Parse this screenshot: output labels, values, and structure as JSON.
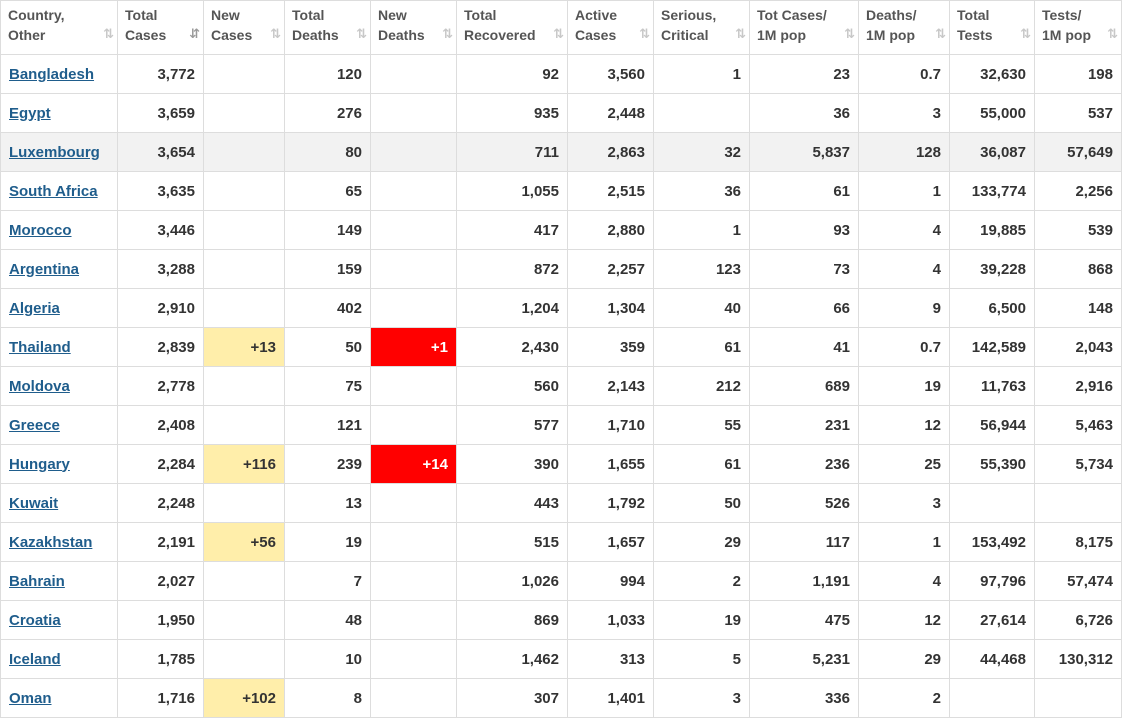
{
  "columns": [
    {
      "line1": "Country,",
      "line2": "Other",
      "sort_glyph": "⇅"
    },
    {
      "line1": "Total",
      "line2": "Cases",
      "sort_glyph": "⇵"
    },
    {
      "line1": "New",
      "line2": "Cases",
      "sort_glyph": "⇅"
    },
    {
      "line1": "Total",
      "line2": "Deaths",
      "sort_glyph": "⇅"
    },
    {
      "line1": "New",
      "line2": "Deaths",
      "sort_glyph": "⇅"
    },
    {
      "line1": "Total",
      "line2": "Recovered",
      "sort_glyph": "⇅"
    },
    {
      "line1": "Active",
      "line2": "Cases",
      "sort_glyph": "⇅"
    },
    {
      "line1": "Serious,",
      "line2": "Critical",
      "sort_glyph": "⇅"
    },
    {
      "line1": "Tot Cases/",
      "line2": "1M pop",
      "sort_glyph": "⇅"
    },
    {
      "line1": "Deaths/",
      "line2": "1M pop",
      "sort_glyph": "⇅"
    },
    {
      "line1": "Total",
      "line2": "Tests",
      "sort_glyph": "⇅"
    },
    {
      "line1": "Tests/",
      "line2": "1M pop",
      "sort_glyph": "⇅"
    }
  ],
  "colors": {
    "new_cases_highlight": "#ffeeaa",
    "new_deaths_highlight": "#ff0000",
    "row_highlight": "#f2f2f2",
    "link": "#1f5d8c"
  },
  "rows": [
    {
      "country": "Bangladesh",
      "total_cases": "3,772",
      "new_cases": "",
      "total_deaths": "120",
      "new_deaths": "",
      "total_recovered": "92",
      "active_cases": "3,560",
      "serious_critical": "1",
      "tot_cases_per_1m": "23",
      "deaths_per_1m": "0.7",
      "total_tests": "32,630",
      "tests_per_1m": "198"
    },
    {
      "country": "Egypt",
      "total_cases": "3,659",
      "new_cases": "",
      "total_deaths": "276",
      "new_deaths": "",
      "total_recovered": "935",
      "active_cases": "2,448",
      "serious_critical": "",
      "tot_cases_per_1m": "36",
      "deaths_per_1m": "3",
      "total_tests": "55,000",
      "tests_per_1m": "537"
    },
    {
      "country": "Luxembourg",
      "total_cases": "3,654",
      "new_cases": "",
      "total_deaths": "80",
      "new_deaths": "",
      "total_recovered": "711",
      "active_cases": "2,863",
      "serious_critical": "32",
      "tot_cases_per_1m": "5,837",
      "deaths_per_1m": "128",
      "total_tests": "36,087",
      "tests_per_1m": "57,649",
      "highlighted": true
    },
    {
      "country": "South Africa",
      "total_cases": "3,635",
      "new_cases": "",
      "total_deaths": "65",
      "new_deaths": "",
      "total_recovered": "1,055",
      "active_cases": "2,515",
      "serious_critical": "36",
      "tot_cases_per_1m": "61",
      "deaths_per_1m": "1",
      "total_tests": "133,774",
      "tests_per_1m": "2,256"
    },
    {
      "country": "Morocco",
      "total_cases": "3,446",
      "new_cases": "",
      "total_deaths": "149",
      "new_deaths": "",
      "total_recovered": "417",
      "active_cases": "2,880",
      "serious_critical": "1",
      "tot_cases_per_1m": "93",
      "deaths_per_1m": "4",
      "total_tests": "19,885",
      "tests_per_1m": "539"
    },
    {
      "country": "Argentina",
      "total_cases": "3,288",
      "new_cases": "",
      "total_deaths": "159",
      "new_deaths": "",
      "total_recovered": "872",
      "active_cases": "2,257",
      "serious_critical": "123",
      "tot_cases_per_1m": "73",
      "deaths_per_1m": "4",
      "total_tests": "39,228",
      "tests_per_1m": "868"
    },
    {
      "country": "Algeria",
      "total_cases": "2,910",
      "new_cases": "",
      "total_deaths": "402",
      "new_deaths": "",
      "total_recovered": "1,204",
      "active_cases": "1,304",
      "serious_critical": "40",
      "tot_cases_per_1m": "66",
      "deaths_per_1m": "9",
      "total_tests": "6,500",
      "tests_per_1m": "148"
    },
    {
      "country": "Thailand",
      "total_cases": "2,839",
      "new_cases": "+13",
      "total_deaths": "50",
      "new_deaths": "+1",
      "total_recovered": "2,430",
      "active_cases": "359",
      "serious_critical": "61",
      "tot_cases_per_1m": "41",
      "deaths_per_1m": "0.7",
      "total_tests": "142,589",
      "tests_per_1m": "2,043"
    },
    {
      "country": "Moldova",
      "total_cases": "2,778",
      "new_cases": "",
      "total_deaths": "75",
      "new_deaths": "",
      "total_recovered": "560",
      "active_cases": "2,143",
      "serious_critical": "212",
      "tot_cases_per_1m": "689",
      "deaths_per_1m": "19",
      "total_tests": "11,763",
      "tests_per_1m": "2,916"
    },
    {
      "country": "Greece",
      "total_cases": "2,408",
      "new_cases": "",
      "total_deaths": "121",
      "new_deaths": "",
      "total_recovered": "577",
      "active_cases": "1,710",
      "serious_critical": "55",
      "tot_cases_per_1m": "231",
      "deaths_per_1m": "12",
      "total_tests": "56,944",
      "tests_per_1m": "5,463"
    },
    {
      "country": "Hungary",
      "total_cases": "2,284",
      "new_cases": "+116",
      "total_deaths": "239",
      "new_deaths": "+14",
      "total_recovered": "390",
      "active_cases": "1,655",
      "serious_critical": "61",
      "tot_cases_per_1m": "236",
      "deaths_per_1m": "25",
      "total_tests": "55,390",
      "tests_per_1m": "5,734"
    },
    {
      "country": "Kuwait",
      "total_cases": "2,248",
      "new_cases": "",
      "total_deaths": "13",
      "new_deaths": "",
      "total_recovered": "443",
      "active_cases": "1,792",
      "serious_critical": "50",
      "tot_cases_per_1m": "526",
      "deaths_per_1m": "3",
      "total_tests": "",
      "tests_per_1m": ""
    },
    {
      "country": "Kazakhstan",
      "total_cases": "2,191",
      "new_cases": "+56",
      "total_deaths": "19",
      "new_deaths": "",
      "total_recovered": "515",
      "active_cases": "1,657",
      "serious_critical": "29",
      "tot_cases_per_1m": "117",
      "deaths_per_1m": "1",
      "total_tests": "153,492",
      "tests_per_1m": "8,175"
    },
    {
      "country": "Bahrain",
      "total_cases": "2,027",
      "new_cases": "",
      "total_deaths": "7",
      "new_deaths": "",
      "total_recovered": "1,026",
      "active_cases": "994",
      "serious_critical": "2",
      "tot_cases_per_1m": "1,191",
      "deaths_per_1m": "4",
      "total_tests": "97,796",
      "tests_per_1m": "57,474"
    },
    {
      "country": "Croatia",
      "total_cases": "1,950",
      "new_cases": "",
      "total_deaths": "48",
      "new_deaths": "",
      "total_recovered": "869",
      "active_cases": "1,033",
      "serious_critical": "19",
      "tot_cases_per_1m": "475",
      "deaths_per_1m": "12",
      "total_tests": "27,614",
      "tests_per_1m": "6,726"
    },
    {
      "country": "Iceland",
      "total_cases": "1,785",
      "new_cases": "",
      "total_deaths": "10",
      "new_deaths": "",
      "total_recovered": "1,462",
      "active_cases": "313",
      "serious_critical": "5",
      "tot_cases_per_1m": "5,231",
      "deaths_per_1m": "29",
      "total_tests": "44,468",
      "tests_per_1m": "130,312"
    },
    {
      "country": "Oman",
      "total_cases": "1,716",
      "new_cases": "+102",
      "total_deaths": "8",
      "new_deaths": "",
      "total_recovered": "307",
      "active_cases": "1,401",
      "serious_critical": "3",
      "tot_cases_per_1m": "336",
      "deaths_per_1m": "2",
      "total_tests": "",
      "tests_per_1m": ""
    }
  ]
}
